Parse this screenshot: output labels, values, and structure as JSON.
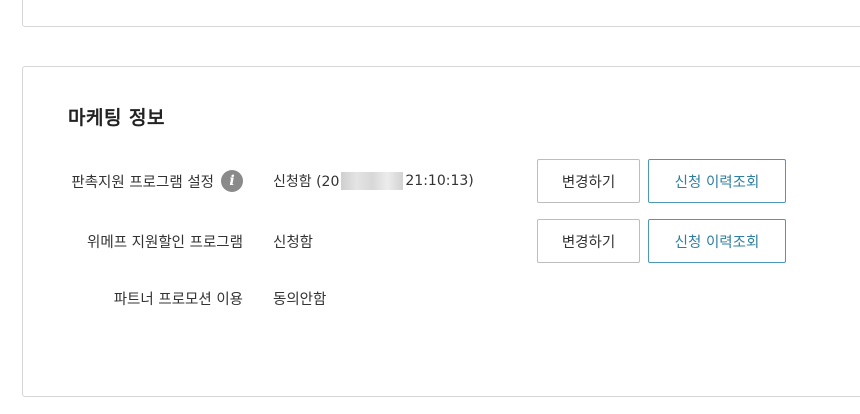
{
  "marketing": {
    "title": "마케팅 정보",
    "rows": [
      {
        "label": "판촉지원 프로그램 설정",
        "info_icon": "info-icon",
        "value_prefix": "신청함 (20",
        "value_suffix": "21:10:13)",
        "change_button": "변경하기",
        "history_button": "신청 이력조회"
      },
      {
        "label": "위메프 지원할인 프로그램",
        "value": "신청함",
        "change_button": "변경하기",
        "history_button": "신청 이력조회"
      },
      {
        "label": "파트너 프로모션 이용",
        "value": "동의안함"
      }
    ]
  },
  "colors": {
    "border": "#d6d6d6",
    "accent": "#2f7fa3",
    "info_icon_bg": "#8a8a8a"
  }
}
